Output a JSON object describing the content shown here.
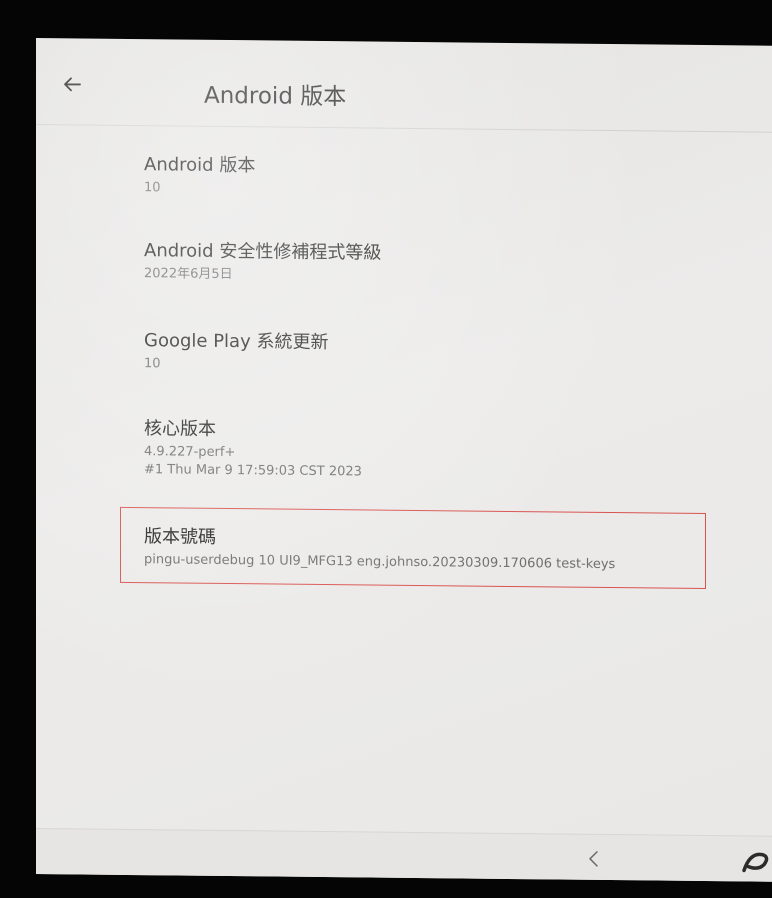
{
  "app_bar": {
    "title": "Android 版本",
    "back_icon": "arrow-left-icon"
  },
  "items": [
    {
      "title": "Android 版本",
      "subtitle": "10"
    },
    {
      "title": "Android 安全性修補程式等級",
      "subtitle": "2022年6月5日"
    },
    {
      "title": "Google Play 系統更新",
      "subtitle": "10"
    },
    {
      "title": "核心版本",
      "subtitle": "4.9.227-perf+",
      "subtitle2": "#1 Thu Mar 9 17:59:03 CST 2023"
    },
    {
      "title": "版本號碼",
      "subtitle": "pingu-userdebug 10 UI9_MFG13 eng.johnso.20230309.170606 test-keys"
    }
  ],
  "highlight": {
    "color": "#d9534f"
  },
  "nav_bar": {
    "back_icon": "chevron-left-icon",
    "edge_icon": "partial-app-icon"
  }
}
